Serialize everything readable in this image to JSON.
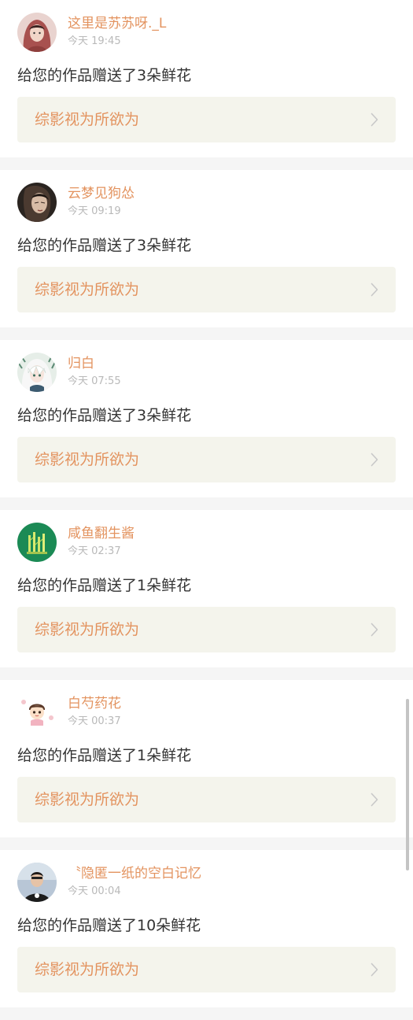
{
  "notifications": [
    {
      "username": "这里是苏苏呀._L",
      "time": "今天 19:45",
      "message": "给您的作品赠送了3朵鲜花",
      "work_title": "综影视为所欲为",
      "avatar": "avatar-girl-red-hood"
    },
    {
      "username": "云梦见狗怂",
      "time": "今天 09:19",
      "message": "给您的作品赠送了3朵鲜花",
      "work_title": "综影视为所欲为",
      "avatar": "avatar-dark-portrait"
    },
    {
      "username": "归白",
      "time": "今天 07:55",
      "message": "给您的作品赠送了3朵鲜花",
      "work_title": "综影视为所欲为",
      "avatar": "avatar-anime-white-hair"
    },
    {
      "username": "咸鱼翻生酱",
      "time": "今天 02:37",
      "message": "给您的作品赠送了1朵鲜花",
      "work_title": "综影视为所欲为",
      "avatar": "avatar-green-bamboo"
    },
    {
      "username": "白芍药花",
      "time": "今天 00:37",
      "message": "给您的作品赠送了1朵鲜花",
      "work_title": "综影视为所欲为",
      "avatar": "avatar-cartoon-boy"
    },
    {
      "username": "〝隐匿一纸的空白记忆",
      "time": "今天 00:04",
      "message": "给您的作品赠送了10朵鲜花",
      "work_title": "综影视为所欲为",
      "avatar": "avatar-man-black-shirt"
    }
  ],
  "colors": {
    "accent": "#e3935f",
    "time": "#b9b9b9",
    "message": "#333333",
    "link_bg": "#f4f4ec",
    "page_bg": "#f5f5f5",
    "chevron": "#c8c8c8"
  }
}
